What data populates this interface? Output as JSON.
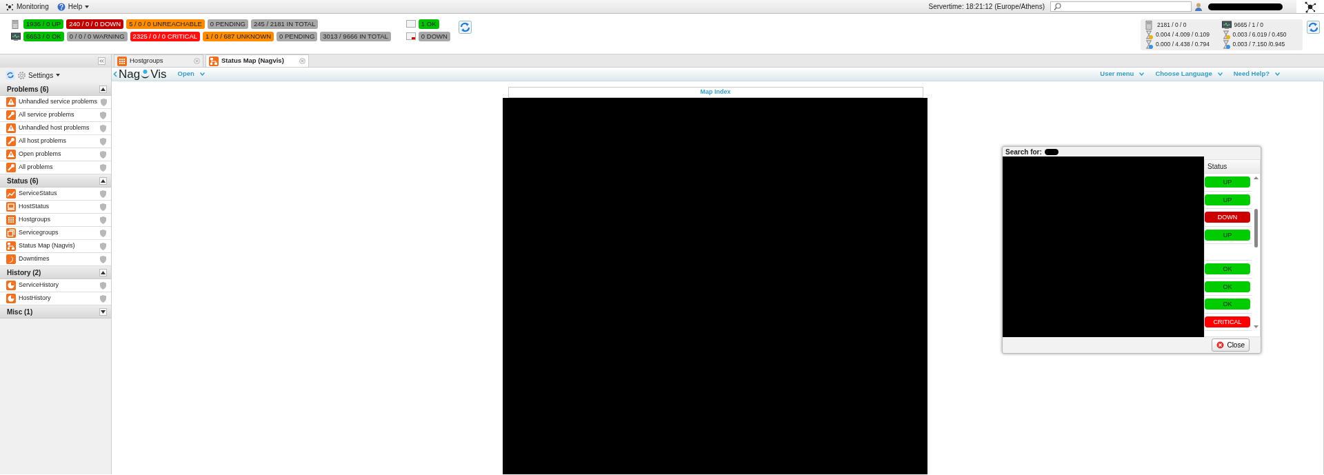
{
  "menubar": {
    "items": [
      {
        "label": "Monitoring",
        "kind": "logo"
      },
      {
        "label": "Help",
        "kind": "help"
      }
    ],
    "servertime": "Servertime: 18:21:12 (Europe/Athens)"
  },
  "host_totals": [
    {
      "text": "1936 / 0 UP",
      "color": "#00c000"
    },
    {
      "text": "240 / 0 / 0 DOWN",
      "color": "#c00000"
    },
    {
      "text": "5 / 0 / 0 UNREACHABLE",
      "color": "#ff8c00"
    },
    {
      "text": "0 PENDING",
      "color": "#a8a8a8"
    },
    {
      "text": "245 / 2181 IN TOTAL",
      "color": "#a8a8a8"
    }
  ],
  "service_totals": [
    {
      "text": "6653 / 0 OK",
      "color": "#00c000"
    },
    {
      "text": "0 / 0 / 0 WARNING",
      "color": "#a8a8a8"
    },
    {
      "text": "2325 / 0 / 0 CRITICAL",
      "color": "#ff1010"
    },
    {
      "text": "1 / 0 / 687 UNKNOWN",
      "color": "#ff8c00"
    },
    {
      "text": "0 PENDING",
      "color": "#a8a8a8"
    },
    {
      "text": "3013 / 9666 IN TOTAL",
      "color": "#a8a8a8"
    }
  ],
  "notifications": [
    {
      "text": "1 OK",
      "color": "#00c000",
      "kind": "ok"
    },
    {
      "text": "0 DOWN",
      "color": "#a8a8a8",
      "kind": "down"
    }
  ],
  "performance": [
    {
      "text": "2181 / 0 / 0",
      "kind": "host"
    },
    {
      "text": "9665 / 1 / 0",
      "kind": "service"
    },
    {
      "text": "0.004 / 4.009 / 0.109",
      "kind": "latency"
    },
    {
      "text": "0.003 / 6.019 / 0.450",
      "kind": "latency"
    },
    {
      "text": "0.000 / 4.438 / 0.794",
      "kind": "exec"
    },
    {
      "text": "0.003 / 7.150 /0.945",
      "kind": "exec"
    }
  ],
  "sidebar": {
    "settings": "Settings",
    "sections": [
      {
        "title": "Problems (6)",
        "expanded": true,
        "items": [
          {
            "label": "Unhandled service problems",
            "kind": "alert"
          },
          {
            "label": "All service problems",
            "kind": "wrench"
          },
          {
            "label": "Unhandled host problems",
            "kind": "alert"
          },
          {
            "label": "All host problems",
            "kind": "wrench"
          },
          {
            "label": "Open problems",
            "kind": "alert"
          },
          {
            "label": "All problems",
            "kind": "wrench"
          }
        ]
      },
      {
        "title": "Status (6)",
        "expanded": true,
        "items": [
          {
            "label": "ServiceStatus",
            "kind": "chart"
          },
          {
            "label": "HostStatus",
            "kind": "host"
          },
          {
            "label": "Hostgroups",
            "kind": "grid"
          },
          {
            "label": "Servicegroups",
            "kind": "window"
          },
          {
            "label": "Status Map (Nagvis)",
            "kind": "map"
          },
          {
            "label": "Downtimes",
            "kind": "moon"
          }
        ]
      },
      {
        "title": "History (2)",
        "expanded": true,
        "items": [
          {
            "label": "ServiceHistory",
            "kind": "pie"
          },
          {
            "label": "HostHistory",
            "kind": "pie"
          }
        ]
      },
      {
        "title": "Misc (1)",
        "expanded": false
      }
    ]
  },
  "tabs": [
    {
      "label": "Hostgroups",
      "kind": "grid",
      "selected": false
    },
    {
      "label": "Status Map (Nagvis)",
      "kind": "map",
      "selected": true
    }
  ],
  "nagvis": {
    "logo_left": "Nag",
    "logo_right": "Vis",
    "left_menus": [
      "Open"
    ],
    "right_menus": [
      "User menu",
      "Choose Language",
      "Need Help?"
    ]
  },
  "map_panel": {
    "title": "Map Index"
  },
  "search_dialog": {
    "title": "Search for:",
    "column": "Status",
    "groups": [
      {
        "rows": [
          {
            "status": "UP",
            "color": "#00cc00"
          },
          {
            "status": "UP",
            "color": "#00cc00"
          },
          {
            "status": "DOWN",
            "color": "#cc0000"
          },
          {
            "status": "UP",
            "color": "#00cc00"
          }
        ]
      },
      {
        "rows": [
          {
            "status": "OK",
            "color": "#00cc00"
          },
          {
            "status": "OK",
            "color": "#00cc00"
          },
          {
            "status": "OK",
            "color": "#00cc00"
          },
          {
            "status": "CRITICAL",
            "color": "#ff0000"
          }
        ]
      }
    ],
    "close": "Close"
  }
}
